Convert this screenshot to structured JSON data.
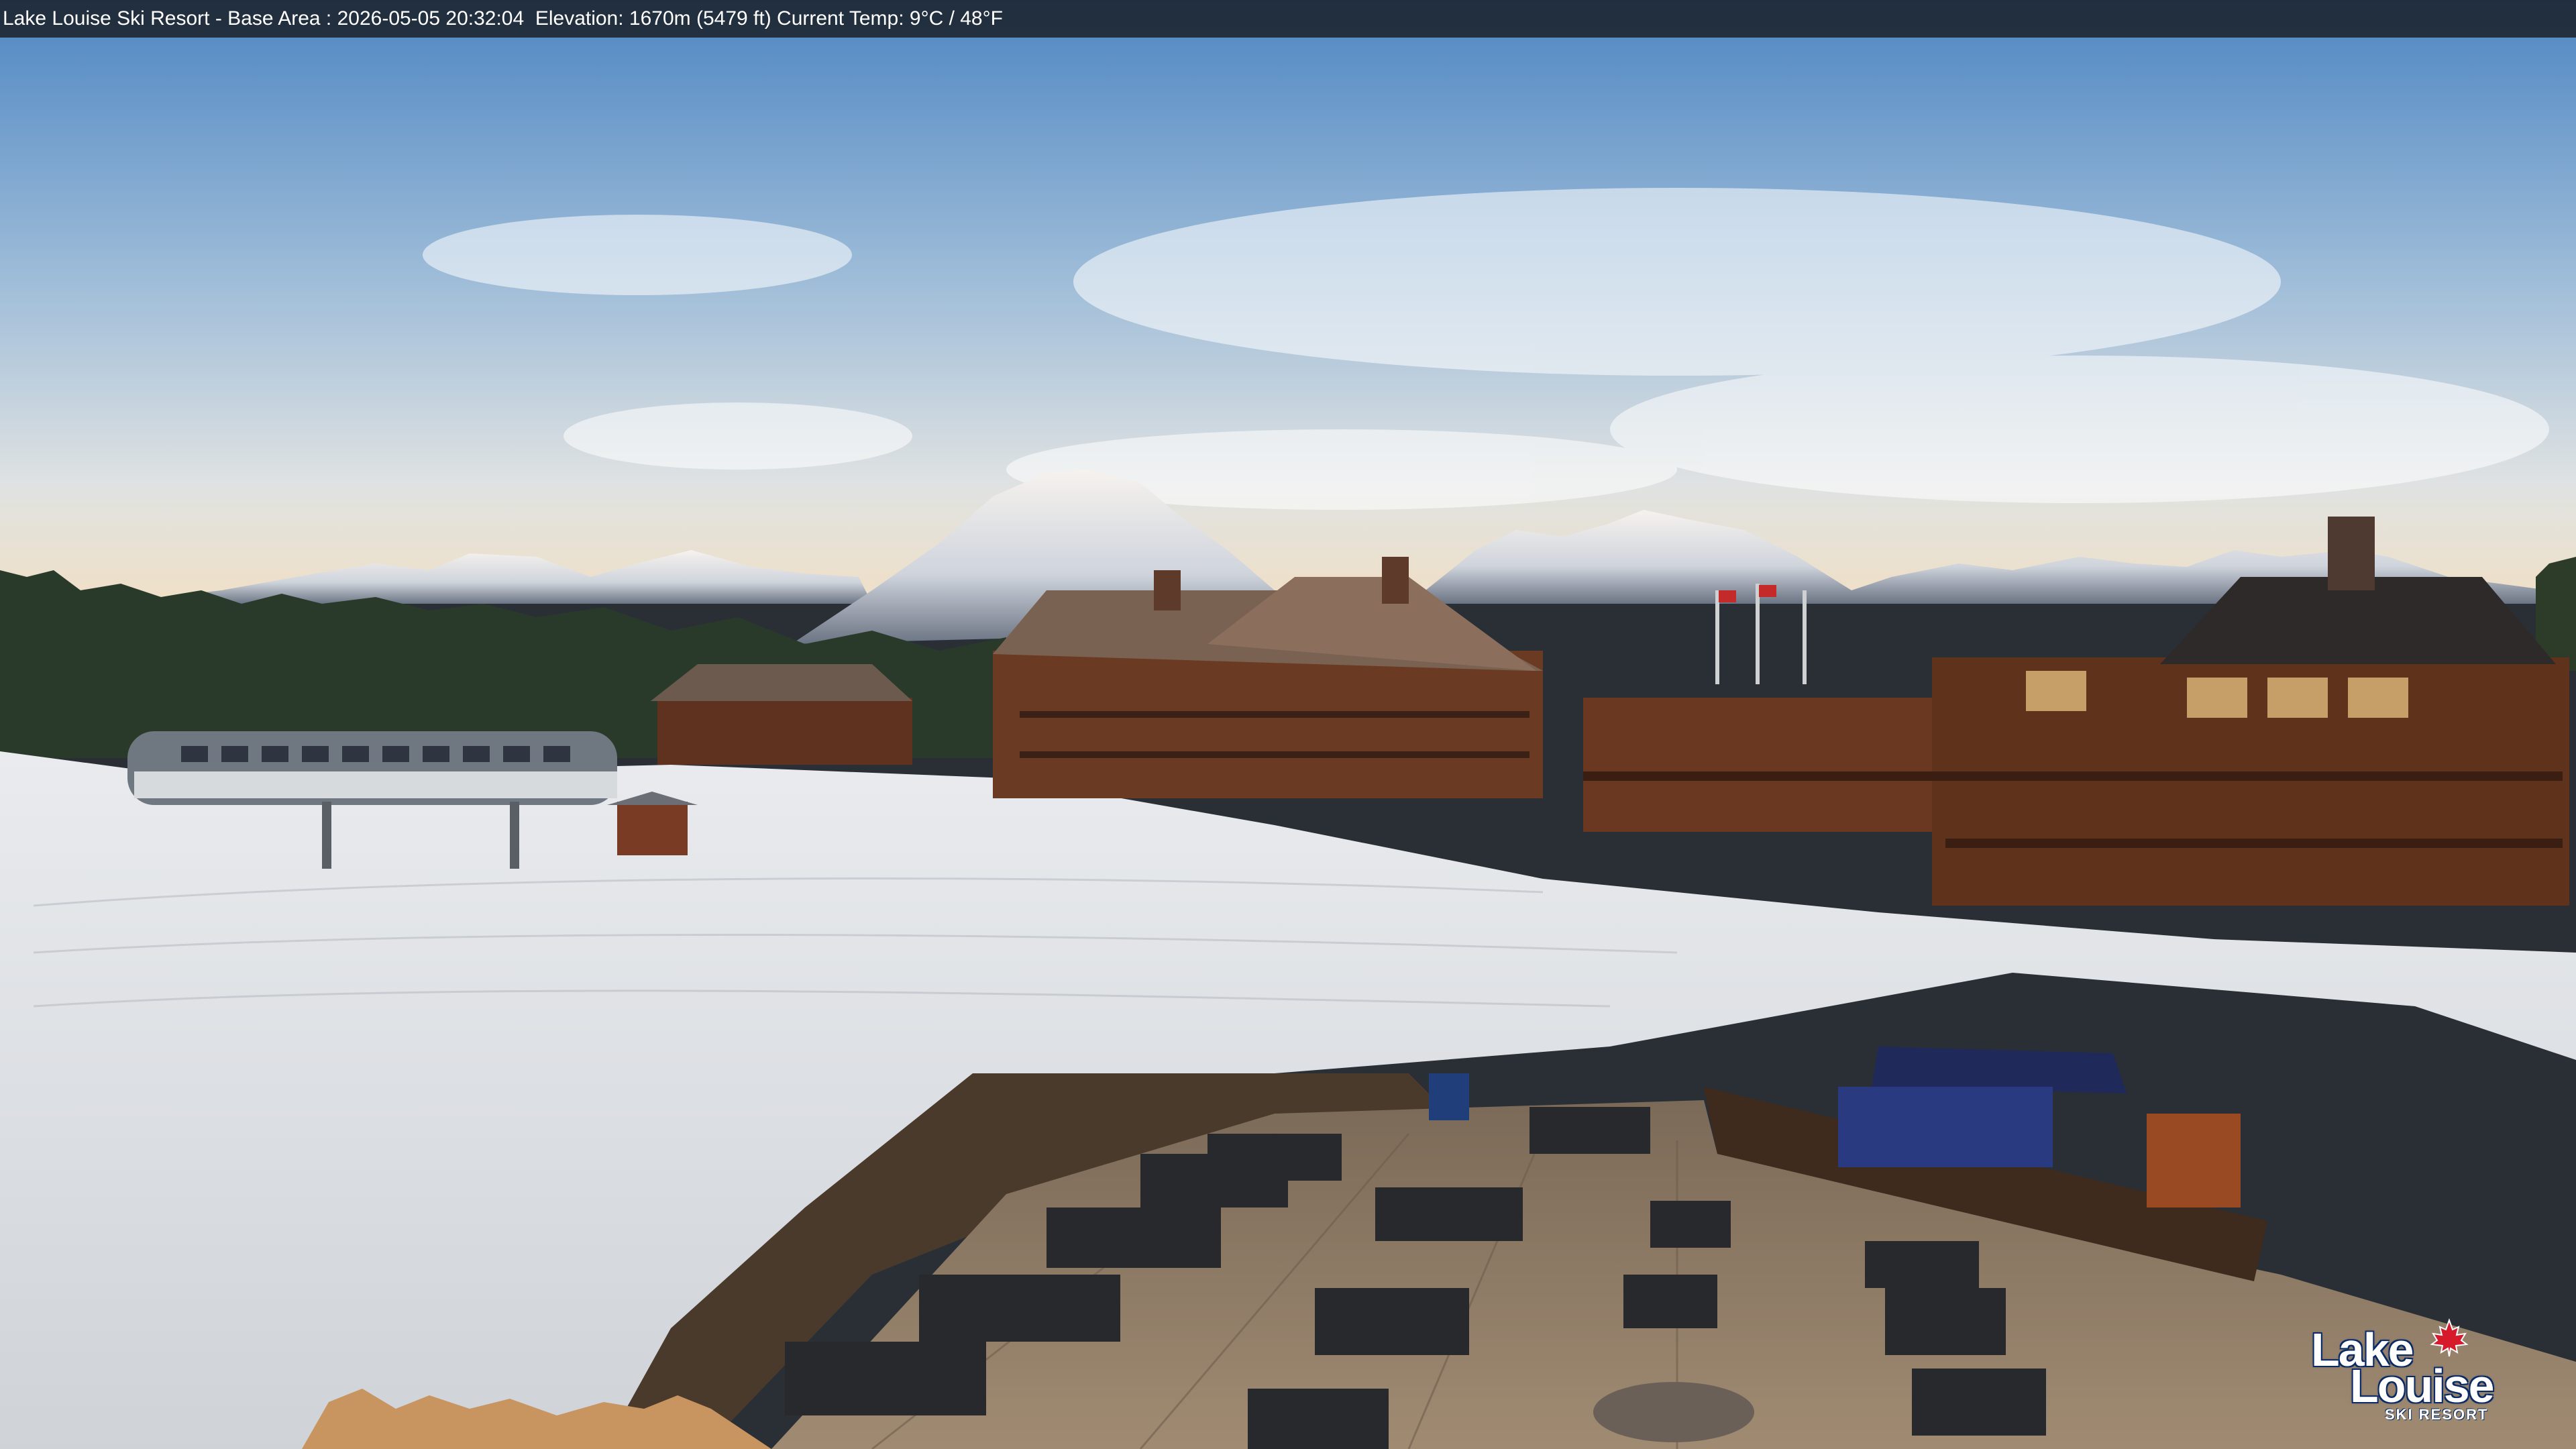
{
  "caption": {
    "text": "Lake Louise Ski Resort - Base Area : 2026-05-05 20:32:04  Elevation: 1670m (5479 ft) Current Temp: 9°C / 48°F"
  },
  "logo": {
    "line1": "Lake",
    "line2": "Louise",
    "line3": "SKI RESORT",
    "leaf_icon": "maple-leaf-icon",
    "leaf_color": "#d6192b"
  },
  "colors": {
    "sky_top": "#5b8fc7",
    "sky_horizon": "#e9dcc7",
    "snow": "#e4e6ea",
    "lodge_wood": "#6b3a22",
    "deck": "#8a7560"
  }
}
